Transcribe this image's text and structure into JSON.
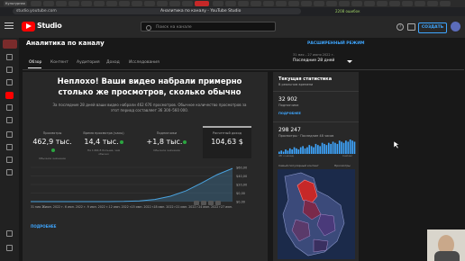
{
  "browser": {
    "first_tab": "Культурная",
    "url": "studio.youtube.com",
    "page_title": "Аналитика по каналу - YouTube Studio",
    "download_badge": "2208 ошибок"
  },
  "header": {
    "brand": "Studio",
    "search_placeholder": "Поиск на канале",
    "create_label": "СОЗДАТЬ"
  },
  "page": {
    "title": "Аналитика по каналу",
    "advanced_mode": "РАСШИРЕННЫЙ РЕЖИМ",
    "date_range": "31 мая – 27 июня 2022 г.",
    "period": "Последние 28 дней",
    "tabs": [
      "Обзор",
      "Контент",
      "Аудитория",
      "Доход",
      "Исследования"
    ]
  },
  "summary": {
    "headline": "Неплохо! Ваши видео набрали примерно столько же просмотров, сколько обычно",
    "description": "За последние 28 дней ваши видео набрали 462 676 просмотров. Обычное количество просмотров за этот период составляет 36 300–560 000."
  },
  "metrics": [
    {
      "label": "Просмотры",
      "value": "462,9 тыс.",
      "note": "Обычное значение"
    },
    {
      "label": "Время просмотра (часы)",
      "value": "14,4 тыс.",
      "note": "На 1464,8 больше, чем обычно"
    },
    {
      "label": "Подписчики",
      "value": "+1,8 тыс.",
      "note": "Обычное значение"
    },
    {
      "label": "Расчетный доход",
      "value": "104,63 $",
      "note": ""
    }
  ],
  "chart_data": {
    "type": "line",
    "x": [
      "31 мая 20...",
      "3 июн. 2022 г.",
      "6 июн. 2022 г.",
      "9 июн. 2022 г.",
      "12 июн. 2022 г.",
      "15 июн. 2022 г.",
      "18 июн. 2022 г.",
      "21 июн. 2022 г.",
      "24 июн. 2022 г.",
      "27 июн."
    ],
    "y_ticks": [
      "$0,00",
      "$0,00",
      "$20,00",
      "$40,00",
      "$60,00"
    ],
    "series": [
      {
        "values": [
          0,
          0,
          0,
          0,
          0,
          0,
          0.3,
          1.5,
          4.5,
          11,
          22,
          38,
          55,
          68
        ]
      }
    ],
    "ylim": [
      0,
      70
    ],
    "more_link": "ПОДРОБНЕЕ"
  },
  "realtime": {
    "title": "Текущая статистика",
    "live_label": "В реальном времени",
    "subscribers_value": "32 902",
    "subscribers_label": "Подписчики",
    "more_label": "ПОДРОБНЕЕ",
    "views_value": "298 247",
    "views_label": "Просмотры · Последние 48 часов",
    "left_axis": "48 ч назад",
    "right_axis": "Сейчас",
    "map_label": "Самый популярный контент",
    "map_label_right": "Просмотры",
    "bars": [
      2,
      3,
      2,
      4,
      3,
      5,
      4,
      6,
      5,
      4,
      6,
      7,
      5,
      6,
      8,
      7,
      6,
      9,
      8,
      7,
      10,
      9,
      8,
      10,
      9,
      11,
      10,
      9,
      12,
      11,
      10,
      12,
      11,
      13,
      12,
      11
    ]
  },
  "colors": {
    "accent": "#3ea6ff",
    "brand_red": "#ff0000",
    "ok_green": "#2ba640",
    "chart_line": "#4aa3df"
  },
  "icons": {
    "logo": "youtube-play-icon",
    "search": "search-icon",
    "help": "help-icon",
    "messages": "message-icon"
  }
}
